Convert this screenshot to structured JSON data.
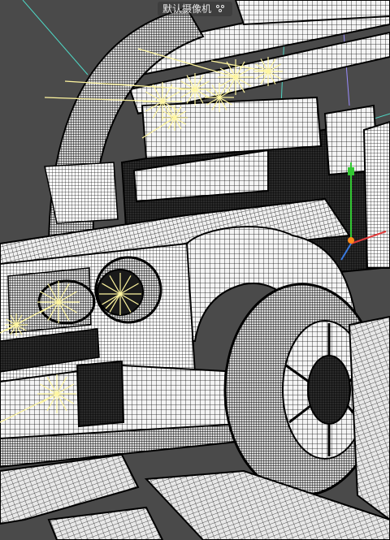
{
  "viewport": {
    "camera_label": "默认摄像机",
    "camera_icon": "camera-settings-icon",
    "background_color": "#4a4a4a",
    "wire_color": "#101010",
    "light_color": "#fff6a0",
    "guide_cyan": "#4fd6c4",
    "guide_purple": "#9a8cff"
  }
}
